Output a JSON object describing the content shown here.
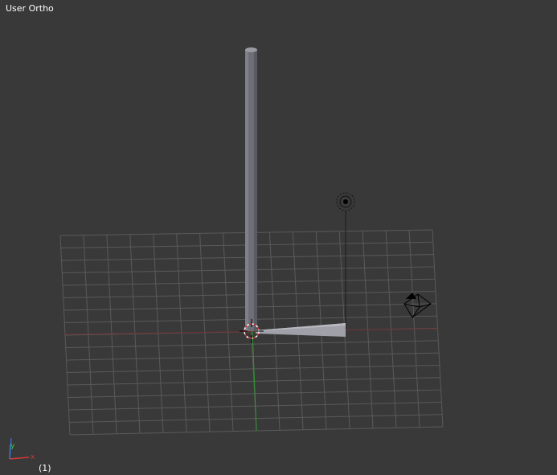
{
  "viewport": {
    "view_name": "User Ortho",
    "frame_indicator": "(1)"
  },
  "axes_widget": {
    "x_label": "x",
    "y_label": "y",
    "x_color": "#d03a3a",
    "y_color": "#3ad03a",
    "z_color": "#3a6ad0"
  },
  "scene": {
    "background_color": "#393939",
    "grid_color": "#5a5a5a",
    "x_axis_color": "#6e3030",
    "y_axis_color": "#2f8f2f",
    "objects": [
      {
        "name": "cylinder-bone",
        "icon": "cylinder-icon"
      },
      {
        "name": "wedge-bone",
        "icon": "wedge-icon"
      },
      {
        "name": "lamp",
        "icon": "lamp-icon"
      },
      {
        "name": "camera",
        "icon": "camera-icon"
      },
      {
        "name": "3d-cursor",
        "icon": "cursor-crosshair-icon"
      }
    ]
  }
}
